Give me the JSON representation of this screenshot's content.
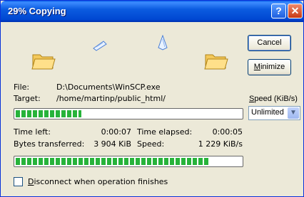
{
  "window": {
    "title": "29% Copying",
    "help_label": "?",
    "close_label": "✕"
  },
  "icons": [
    "folder-source-icon",
    "paper-flying-icon",
    "paper-flying-icon",
    "folder-target-icon"
  ],
  "file": {
    "label": "File:",
    "value": "D:\\Documents\\WinSCP.exe"
  },
  "target": {
    "label": "Target:",
    "value": "/home/martinp/public_html/"
  },
  "buttons": {
    "cancel_label": "Cancel",
    "minimize_first": "M",
    "minimize_rest": "inimize"
  },
  "speed": {
    "label_first": "S",
    "label_rest": "peed (KiB/s)",
    "selected": "Unlimited"
  },
  "file_progress": 0.29,
  "total_progress": 0.86,
  "stats": {
    "time_left_label": "Time left:",
    "time_left_value": "0:00:07",
    "time_elapsed_label": "Time elapsed:",
    "time_elapsed_value": "0:00:05",
    "bytes_label": "Bytes transferred:",
    "bytes_value": "3 904 KiB",
    "speed_label": "Speed:",
    "speed_value": "1 229 KiB/s"
  },
  "disconnect": {
    "label_first": "D",
    "label_rest": "isconnect when operation finishes",
    "checked": false
  },
  "colors": {
    "title_bar": "#0054e3",
    "progress": "#27b33a",
    "face": "#ece9d8"
  }
}
